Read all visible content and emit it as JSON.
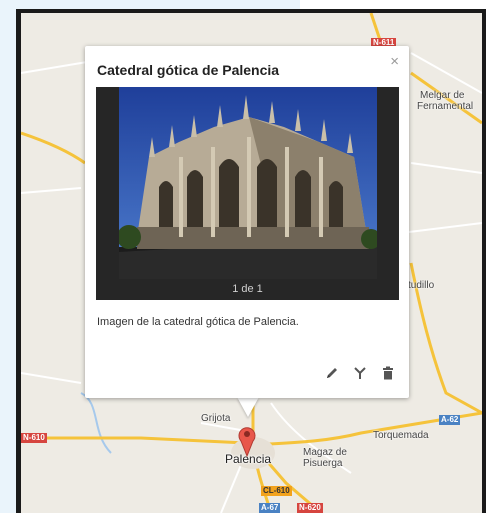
{
  "popup": {
    "title": "Catedral gótica de Palencia",
    "close_glyph": "×",
    "photo_counter": "1 de 1",
    "description": "Imagen de la catedral gótica de Palencia.",
    "actions": [
      {
        "icon": "pencil-icon",
        "label": "edit"
      },
      {
        "icon": "style-icon",
        "label": "style"
      },
      {
        "icon": "trash-icon",
        "label": "delete"
      }
    ]
  },
  "map": {
    "places": {
      "melgar": "Melgar de",
      "melgar2": "Fernamental",
      "astudillo": "tudillo",
      "grijota": "Grijota",
      "torquemada": "Torquemada",
      "palencia": "Palencia",
      "magaz": "Magaz de",
      "magaz2": "Pisuerga"
    },
    "roads": {
      "n611": "N-611",
      "n610": "N-610",
      "a62": "A-62",
      "cl610": "CL-610",
      "a67": "A-67",
      "n620": "N-620"
    },
    "colors": {
      "highway": "#f5c33b",
      "road": "#ffffff",
      "water": "#a6c9ec",
      "marker": "#e8574b"
    }
  }
}
